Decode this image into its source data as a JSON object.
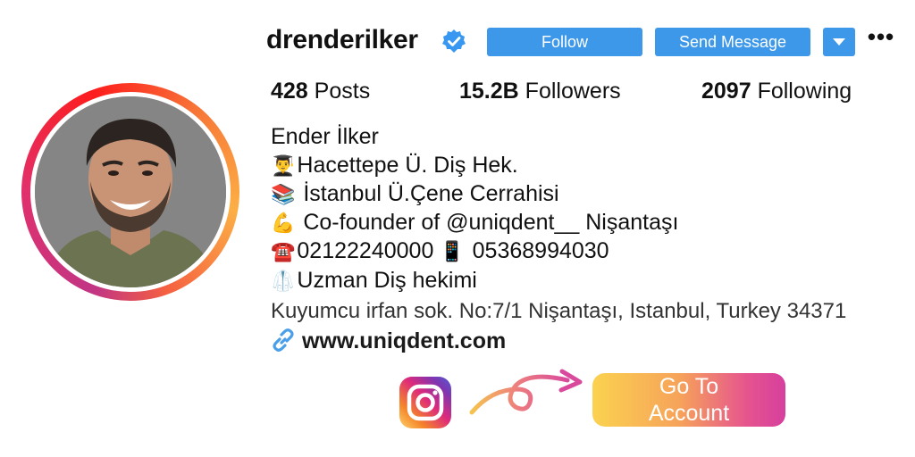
{
  "profile": {
    "username": "drenderilker",
    "verified_icon": "verified-badge-icon",
    "buttons": {
      "follow": "Follow",
      "message": "Send Message",
      "dropdown_icon": "chevron-down-icon",
      "more": "•••"
    },
    "stats": {
      "posts_count": "428",
      "posts_label": "Posts",
      "followers_count": "15.2B",
      "followers_label": "Followers",
      "following_count": "2097",
      "following_label": "Following"
    },
    "bio": {
      "name": "Ender İlker",
      "line1_emoji": "👨‍🎓",
      "line1": "Hacettepe Ü. Diş Hek.",
      "line2_emoji": "📚",
      "line2": " İstanbul Ü.Çene Cerrahisi",
      "line3_emoji": "💪",
      "line3": " Co-founder of @uniqdent__ Nişantaşı",
      "line4_emoji": "☎️",
      "line4a": "02122240000 ",
      "line4_emoji2": "📱",
      "line4b": " 05368994030",
      "line5_emoji": "🥼",
      "line5": "Uzman Diş hekimi",
      "address": "Kuyumcu irfan sok. No:7/1 Nişantaşı, Istanbul, Turkey 34371",
      "link_icon": "link-icon",
      "link": "www.uniqdent.com"
    }
  },
  "cta": {
    "logo_icon": "instagram-logo-icon",
    "arrow_icon": "curly-arrow-icon",
    "button_line1": "Go To",
    "button_line2": "Account"
  },
  "colors": {
    "button_blue": "#3d98ea",
    "verified_blue": "#3897f0",
    "gradient_pink": "#d63f9d",
    "gradient_yellow": "#fbd24f"
  }
}
